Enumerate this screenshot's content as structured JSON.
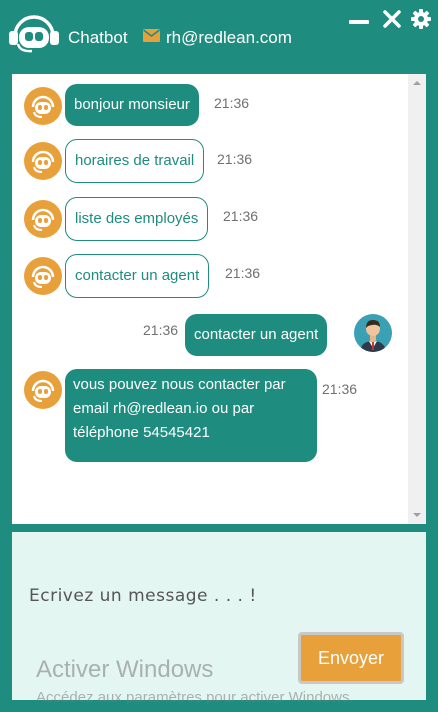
{
  "header": {
    "app_name": "Chatbot",
    "contact_email": "rh@redlean.com",
    "icons": [
      "chatbot-logo-icon",
      "mail-icon",
      "minimize-icon",
      "close-icon",
      "gear-icon"
    ]
  },
  "messages": [
    {
      "sender": "bot",
      "style": "filled",
      "text": "bonjour monsieur",
      "time": "21:36"
    },
    {
      "sender": "bot",
      "style": "outline",
      "text": "horaires de travail",
      "time": "21:36"
    },
    {
      "sender": "bot",
      "style": "outline",
      "text": "liste des employés",
      "time": "21:36"
    },
    {
      "sender": "bot",
      "style": "outline",
      "text": "contacter un agent",
      "time": "21:36"
    },
    {
      "sender": "user",
      "style": "filled",
      "text": "contacter un agent",
      "time": "21:36"
    },
    {
      "sender": "bot",
      "style": "filled",
      "text_lines": [
        "vous pouvez nous contacter par",
        "email rh@redlean.io ou par",
        "téléphone 54545421"
      ],
      "time": "21:36"
    }
  ],
  "composer": {
    "placeholder": "Ecrivez un message . . . !",
    "value": "",
    "send_label": "Envoyer"
  },
  "watermark": {
    "title": "Activer Windows",
    "subtitle": "Accédez aux paramètres pour activer Windows."
  },
  "colors": {
    "brand_teal": "#1e8c7e",
    "accent_orange": "#e8a03a",
    "composer_bg": "#e4f6f2"
  }
}
